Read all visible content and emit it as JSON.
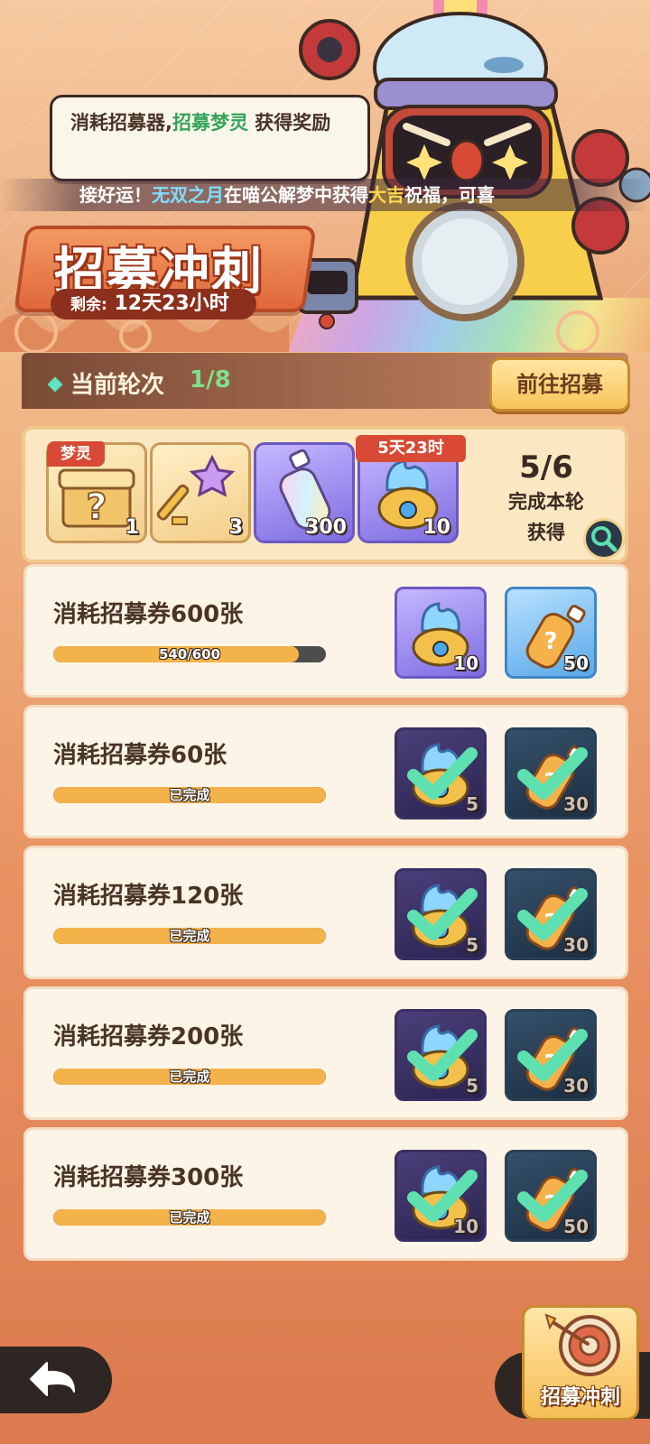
{
  "banner": {
    "tooltip_prefix": "消耗招募器,",
    "tooltip_highlight": "招募梦灵",
    "tooltip_suffix": " 获得奖励",
    "marquee_prefix": "接好运！",
    "marquee_name": "无双之月",
    "marquee_mid": "在喵公解梦中获得",
    "marquee_luck": "大吉",
    "marquee_suffix": "祝福，可喜",
    "title": "招募冲刺",
    "remain_label": "剩余:",
    "remain_value": "12天23小时"
  },
  "round": {
    "label": "当前轮次",
    "value": "1/8",
    "goto_button": "前往招募"
  },
  "round_rewards": {
    "items": [
      {
        "icon": "mystery-chest-icon",
        "tag": "梦灵",
        "count": "1"
      },
      {
        "icon": "star-key-icon",
        "count": "3"
      },
      {
        "icon": "rainbow-bottle-icon",
        "count": "300"
      },
      {
        "icon": "blue-flame-pot-icon",
        "tag": "5天23时",
        "count": "10"
      }
    ],
    "progress": "5/6",
    "progress_line1": "完成本轮",
    "progress_line2": "获得"
  },
  "tasks": [
    {
      "title": "消耗招募券600张",
      "current": 540,
      "target": 600,
      "bar_text": "540/600",
      "done": false,
      "rewards": [
        {
          "icon": "blue-flame-pot-icon",
          "count": "10"
        },
        {
          "icon": "mystery-bottle-icon",
          "count": "50"
        }
      ]
    },
    {
      "title": "消耗招募券60张",
      "bar_text": "已完成",
      "done": true,
      "rewards": [
        {
          "icon": "blue-flame-pot-icon",
          "count": "5"
        },
        {
          "icon": "mystery-bottle-icon",
          "count": "30"
        }
      ]
    },
    {
      "title": "消耗招募券120张",
      "bar_text": "已完成",
      "done": true,
      "rewards": [
        {
          "icon": "blue-flame-pot-icon",
          "count": "5"
        },
        {
          "icon": "mystery-bottle-icon",
          "count": "30"
        }
      ]
    },
    {
      "title": "消耗招募券200张",
      "bar_text": "已完成",
      "done": true,
      "rewards": [
        {
          "icon": "blue-flame-pot-icon",
          "count": "5"
        },
        {
          "icon": "mystery-bottle-icon",
          "count": "30"
        }
      ]
    },
    {
      "title": "消耗招募券300张",
      "bar_text": "已完成",
      "done": true,
      "rewards": [
        {
          "icon": "blue-flame-pot-icon",
          "count": "10"
        },
        {
          "icon": "mystery-bottle-icon",
          "count": "50"
        }
      ]
    }
  ],
  "bottom": {
    "back_icon": "back-arrow-icon",
    "sprint_label": "招募冲刺",
    "sprint_icon": "dartboard-icon"
  },
  "colors": {
    "accent_green": "#36a35a",
    "progress_fill": "#f4b24a",
    "check_green": "#5ee0b0",
    "tag_red": "#d84a35"
  }
}
